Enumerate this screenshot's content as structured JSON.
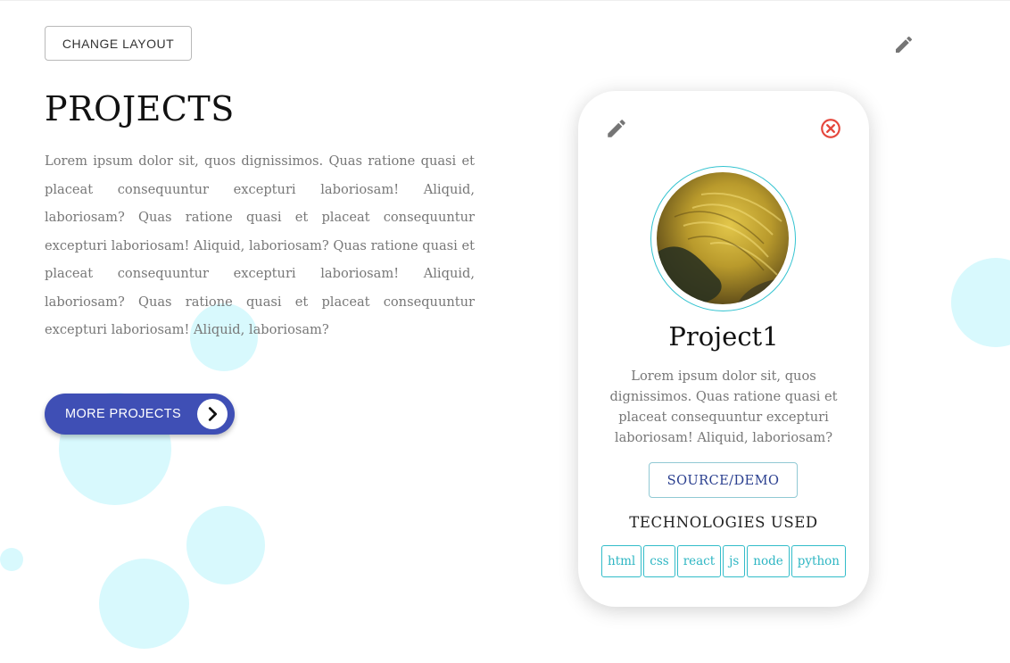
{
  "toolbar": {
    "change_layout_label": "CHANGE LAYOUT",
    "edit_icon": "pencil-icon"
  },
  "section": {
    "title": "PROJECTS",
    "description": "Lorem ipsum dolor sit, quos dignissimos. Quas ratione quasi et placeat consequuntur excepturi laboriosam! Aliquid, laboriosam? Quas ratione quasi et placeat consequuntur excepturi laboriosam! Aliquid, laboriosam? Quas ratione quasi et placeat consequuntur excepturi laboriosam! Aliquid, laboriosam? Quas ratione quasi et placeat consequuntur excepturi laboriosam! Aliquid, laboriosam?",
    "more_label": "MORE PROJECTS",
    "more_icon": "chevron-right-icon"
  },
  "project": {
    "edit_icon": "pencil-icon",
    "close_icon": "close-circle-icon",
    "name": "Project1",
    "description": "Lorem ipsum dolor sit, quos dignissimos. Quas ratione quasi et placeat consequuntur excepturi laboriosam! Aliquid, laboriosam?",
    "source_label": "SOURCE/DEMO",
    "technologies_heading": "TECHNOLOGIES USED",
    "technologies": [
      "html",
      "css",
      "react",
      "js",
      "node",
      "python"
    ]
  },
  "colors": {
    "primary": "#3f4fb5",
    "accent": "#33bcc9",
    "danger": "#e5473c",
    "bubble": "#d8f9fd"
  }
}
